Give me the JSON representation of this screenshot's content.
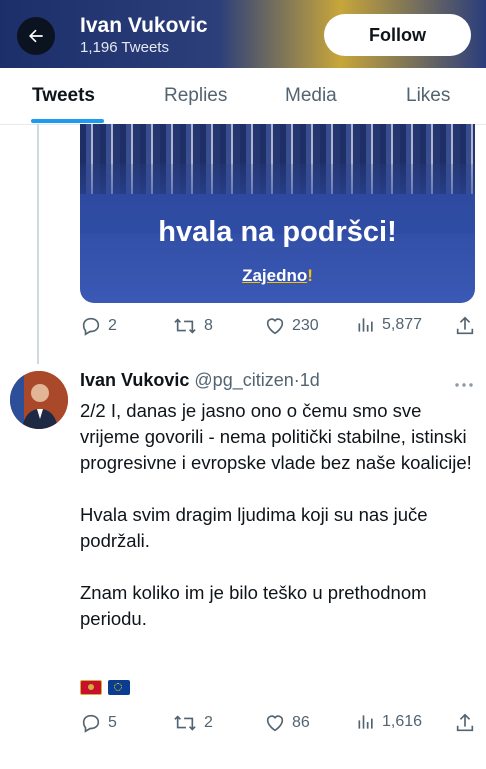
{
  "header": {
    "name": "Ivan Vukovic",
    "tweet_count": "1,196 Tweets",
    "follow_label": "Follow",
    "back_icon": "arrow-left-icon"
  },
  "tabs": [
    {
      "label": "Tweets",
      "active": true
    },
    {
      "label": "Replies",
      "active": false
    },
    {
      "label": "Media",
      "active": false
    },
    {
      "label": "Likes",
      "active": false
    }
  ],
  "tweet1": {
    "media": {
      "caption": "hvala na podršci!",
      "brand": "Zajedno",
      "brand_mark": "!"
    },
    "actions": {
      "replies": "2",
      "retweets": "8",
      "likes": "230",
      "views": "5,877"
    }
  },
  "tweet2": {
    "name": "Ivan Vukovic",
    "handle": "@pg_citizen",
    "separator": "·",
    "time": "1d",
    "paragraphs": [
      "2/2 I, danas je jasno ono o čemu smo sve vrijeme govorili - nema politički stabilne, istinski progresivne i evropske vlade bez naše koalicije!",
      "Hvala svim dragim ljudima koji su nas juče podržali.",
      "Znam koliko im je bilo teško u prethodnom periodu."
    ],
    "flags": [
      "flag-montenegro-icon",
      "flag-eu-icon"
    ],
    "actions": {
      "replies": "5",
      "retweets": "2",
      "likes": "86",
      "views": "1,616"
    }
  },
  "colors": {
    "accent": "#1d9bf0",
    "text": "#0f1419",
    "secondary": "#536471",
    "card_blue": "#2f4ba0",
    "brand_yellow": "#f4c20d"
  }
}
